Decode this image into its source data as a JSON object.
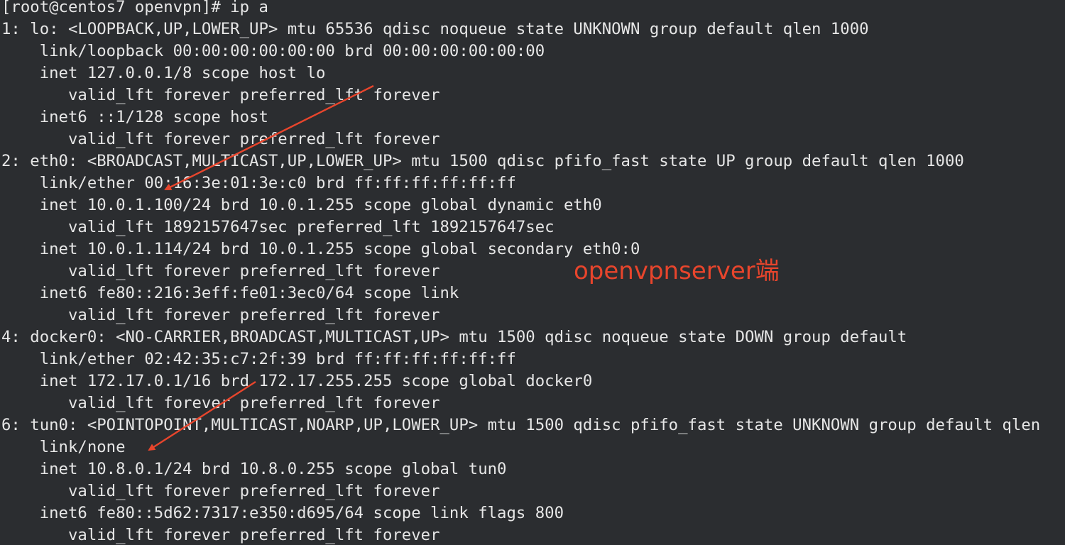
{
  "terminal": {
    "lines": [
      "[root@centos7 openvpn]# ip a",
      "1: lo: <LOOPBACK,UP,LOWER_UP> mtu 65536 qdisc noqueue state UNKNOWN group default qlen 1000",
      "    link/loopback 00:00:00:00:00:00 brd 00:00:00:00:00:00",
      "    inet 127.0.0.1/8 scope host lo",
      "       valid_lft forever preferred_lft forever",
      "    inet6 ::1/128 scope host",
      "       valid_lft forever preferred_lft forever",
      "2: eth0: <BROADCAST,MULTICAST,UP,LOWER_UP> mtu 1500 qdisc pfifo_fast state UP group default qlen 1000",
      "    link/ether 00:16:3e:01:3e:c0 brd ff:ff:ff:ff:ff:ff",
      "    inet 10.0.1.100/24 brd 10.0.1.255 scope global dynamic eth0",
      "       valid_lft 1892157647sec preferred_lft 1892157647sec",
      "    inet 10.0.1.114/24 brd 10.0.1.255 scope global secondary eth0:0",
      "       valid_lft forever preferred_lft forever",
      "    inet6 fe80::216:3eff:fe01:3ec0/64 scope link",
      "       valid_lft forever preferred_lft forever",
      "4: docker0: <NO-CARRIER,BROADCAST,MULTICAST,UP> mtu 1500 qdisc noqueue state DOWN group default",
      "    link/ether 02:42:35:c7:2f:39 brd ff:ff:ff:ff:ff:ff",
      "    inet 172.17.0.1/16 brd 172.17.255.255 scope global docker0",
      "       valid_lft forever preferred_lft forever",
      "6: tun0: <POINTOPOINT,MULTICAST,NOARP,UP,LOWER_UP> mtu 1500 qdisc pfifo_fast state UNKNOWN group default qlen",
      "    link/none",
      "    inet 10.8.0.1/24 brd 10.8.0.255 scope global tun0",
      "       valid_lft forever preferred_lft forever",
      "    inet6 fe80::5d62:7317:e350:d695/64 scope link flags 800",
      "       valid_lft forever preferred_lft forever"
    ]
  },
  "annotation": {
    "label": "openvpnserver端",
    "color": "#e8452c"
  },
  "colors": {
    "background": "#2b2d30",
    "text": "#e6e6e6"
  }
}
